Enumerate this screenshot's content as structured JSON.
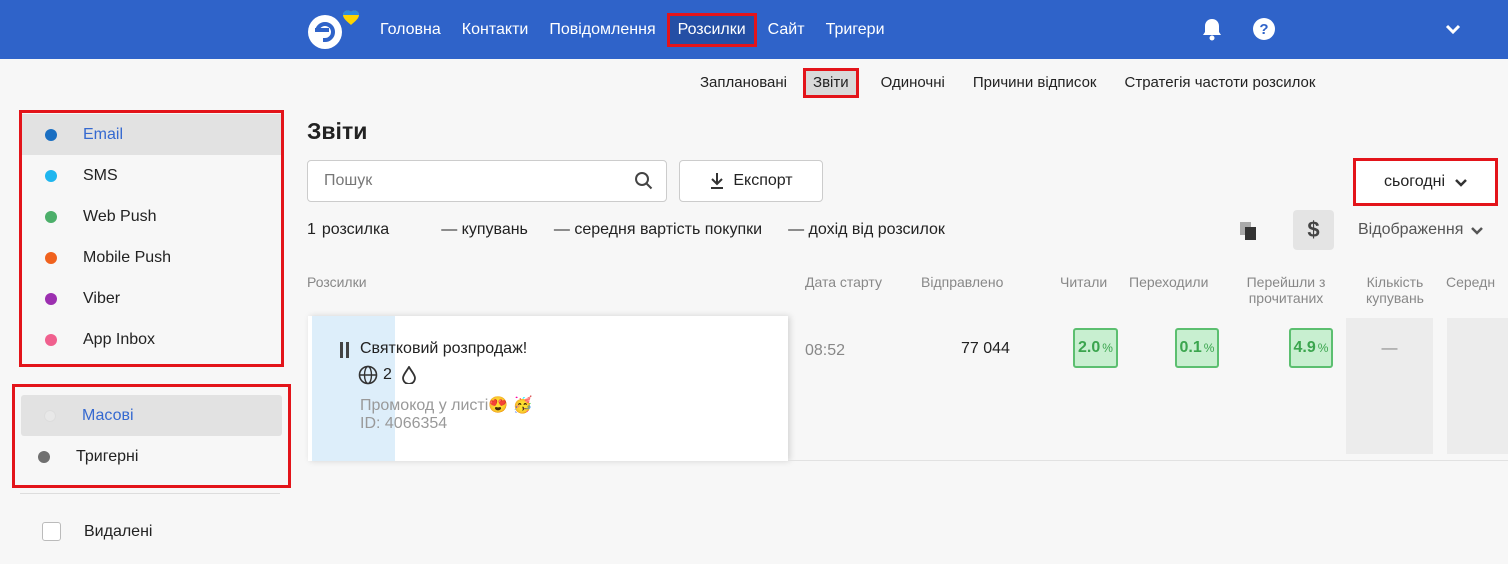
{
  "nav": {
    "items": [
      "Головна",
      "Контакти",
      "Повідомлення",
      "Розсилки",
      "Сайт",
      "Тригери"
    ],
    "active": "Розсилки"
  },
  "subnav": {
    "items": [
      "Заплановані",
      "Звіти",
      "Одиночні",
      "Причини відписок",
      "Стратегія частоти розсилок"
    ],
    "active": "Звіти"
  },
  "sidebar": {
    "channels": [
      {
        "label": "Email",
        "color": "#1a6fc2",
        "active": true
      },
      {
        "label": "SMS",
        "color": "#1fb6ef",
        "active": false
      },
      {
        "label": "Web Push",
        "color": "#4caf6a",
        "active": false
      },
      {
        "label": "Mobile Push",
        "color": "#f0621e",
        "active": false
      },
      {
        "label": "Viber",
        "color": "#9c2fb0",
        "active": false
      },
      {
        "label": "App Inbox",
        "color": "#f0608e",
        "active": false
      }
    ],
    "kinds": [
      {
        "label": "Масові",
        "color": "#e8e8e8",
        "active": true
      },
      {
        "label": "Тригерні",
        "color": "#707070",
        "active": false
      }
    ],
    "deleted_label": "Видалені"
  },
  "main": {
    "title": "Звіти",
    "search_placeholder": "Пошук",
    "export_label": "Експорт",
    "period_label": "сьогодні",
    "view_label": "Відображення",
    "summary": {
      "count": "1",
      "count_label": "розсилка",
      "purchases": "— купувань",
      "avg_price": "— середня вартість покупки",
      "revenue": "— дохід від розсилок"
    }
  },
  "table": {
    "headers": {
      "campaigns": "Розсилки",
      "start_date": "Дата старту",
      "sent": "Відправлено",
      "read": "Читали",
      "clicked": "Переходили",
      "ctor_1": "Перейшли з",
      "ctor_2": "прочитаних",
      "purchases_1": "Кількість",
      "purchases_2": "купувань",
      "avg": "Середн"
    },
    "row": {
      "name": "Святковий розпродаж!",
      "sites": "2",
      "description": "Промокод у листі😍 🥳",
      "id": "ID: 4066354",
      "start": "08:52",
      "sent": "77 044",
      "read": "2.0",
      "clicked": "0.1",
      "ctor": "4.9",
      "purchases": "—",
      "pct": "%"
    }
  },
  "colors": {
    "topbar": "#2f63c9",
    "highlight": "#e3141a",
    "badge_bg": "#c8efd0",
    "badge_text": "#3ba54e"
  }
}
